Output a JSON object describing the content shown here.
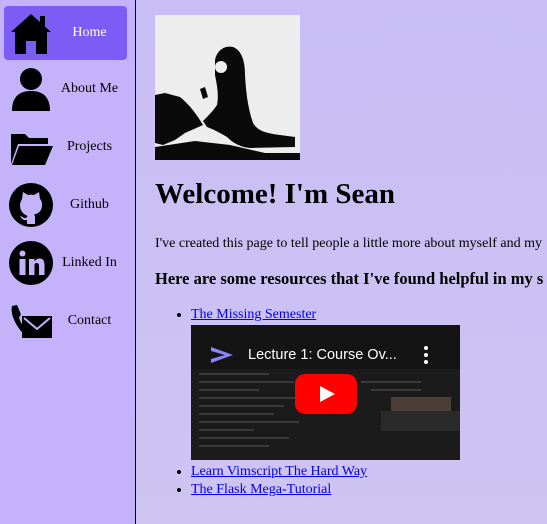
{
  "sidebar": {
    "items": [
      {
        "label": "Home",
        "icon": "home-icon",
        "active": true
      },
      {
        "label": "About Me",
        "icon": "user-icon",
        "active": false
      },
      {
        "label": "Projects",
        "icon": "folder-icon",
        "active": false
      },
      {
        "label": "Github",
        "icon": "github-icon",
        "active": false
      },
      {
        "label": "Linked In",
        "icon": "linkedin-icon",
        "active": false
      },
      {
        "label": "Contact",
        "icon": "envelope-phone-icon",
        "active": false
      }
    ]
  },
  "main": {
    "title": "Welcome! I'm Sean",
    "intro": "I've created this page to tell people a little more about myself and my",
    "resources_heading": "Here are some resources that I've found helpful in my s",
    "resources": [
      {
        "label": "The Missing Semester"
      },
      {
        "label": "Learn Vimscript The Hard Way"
      },
      {
        "label": "The Flask Mega-Tutorial"
      }
    ],
    "video": {
      "title": "Lecture 1: Course Ov..."
    }
  },
  "colors": {
    "background": "#c8bdf6",
    "sidebar": "#c4b2fb",
    "active_nav": "#7b5cf5",
    "link": "#0000ee",
    "play_button": "#ff0000"
  }
}
